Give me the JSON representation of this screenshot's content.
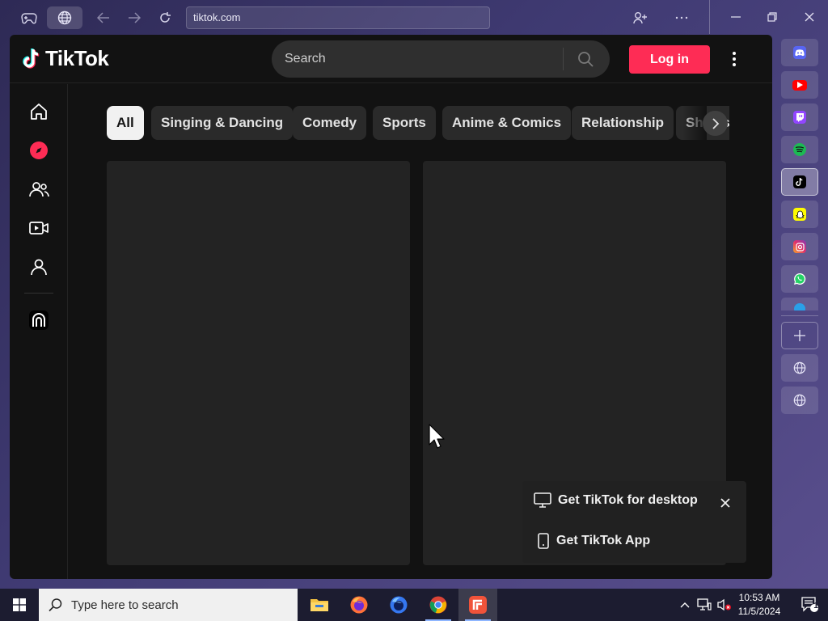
{
  "browser": {
    "url": "tiktok.com",
    "icons": [
      "gamepad-icon",
      "globe-icon",
      "back-arrow-icon",
      "forward-arrow-icon",
      "reload-icon",
      "add-person-icon",
      "more-icon",
      "minimize-icon",
      "restore-icon",
      "close-icon"
    ]
  },
  "tiktok": {
    "logo_text": "TikTok",
    "search_placeholder": "Search",
    "login_label": "Log in",
    "nav_icons": [
      "home-icon",
      "explore-icon",
      "following-icon",
      "live-video-icon",
      "profile-icon",
      "activity-icon"
    ],
    "categories": [
      "All",
      "Singing & Dancing",
      "Comedy",
      "Sports",
      "Anime & Comics",
      "Relationship",
      "Shows"
    ],
    "active_category": "All",
    "promo": {
      "desktop_label": "Get TikTok for desktop",
      "app_label": "Get TikTok App"
    },
    "accent_color": "#fe2c55"
  },
  "dock": {
    "apps": [
      "discord",
      "youtube",
      "twitch",
      "spotify",
      "tiktok",
      "snapchat",
      "instagram",
      "whatsapp"
    ],
    "selected": "tiktok",
    "extra": [
      "add-icon",
      "globe-icon",
      "globe-icon"
    ]
  },
  "taskbar": {
    "search_placeholder": "Type here to search",
    "apps": [
      "file-explorer",
      "firefox",
      "firefox-developer",
      "chrome",
      "app-red"
    ],
    "time": "10:53 AM",
    "date": "11/5/2024",
    "notification_count": "1"
  }
}
